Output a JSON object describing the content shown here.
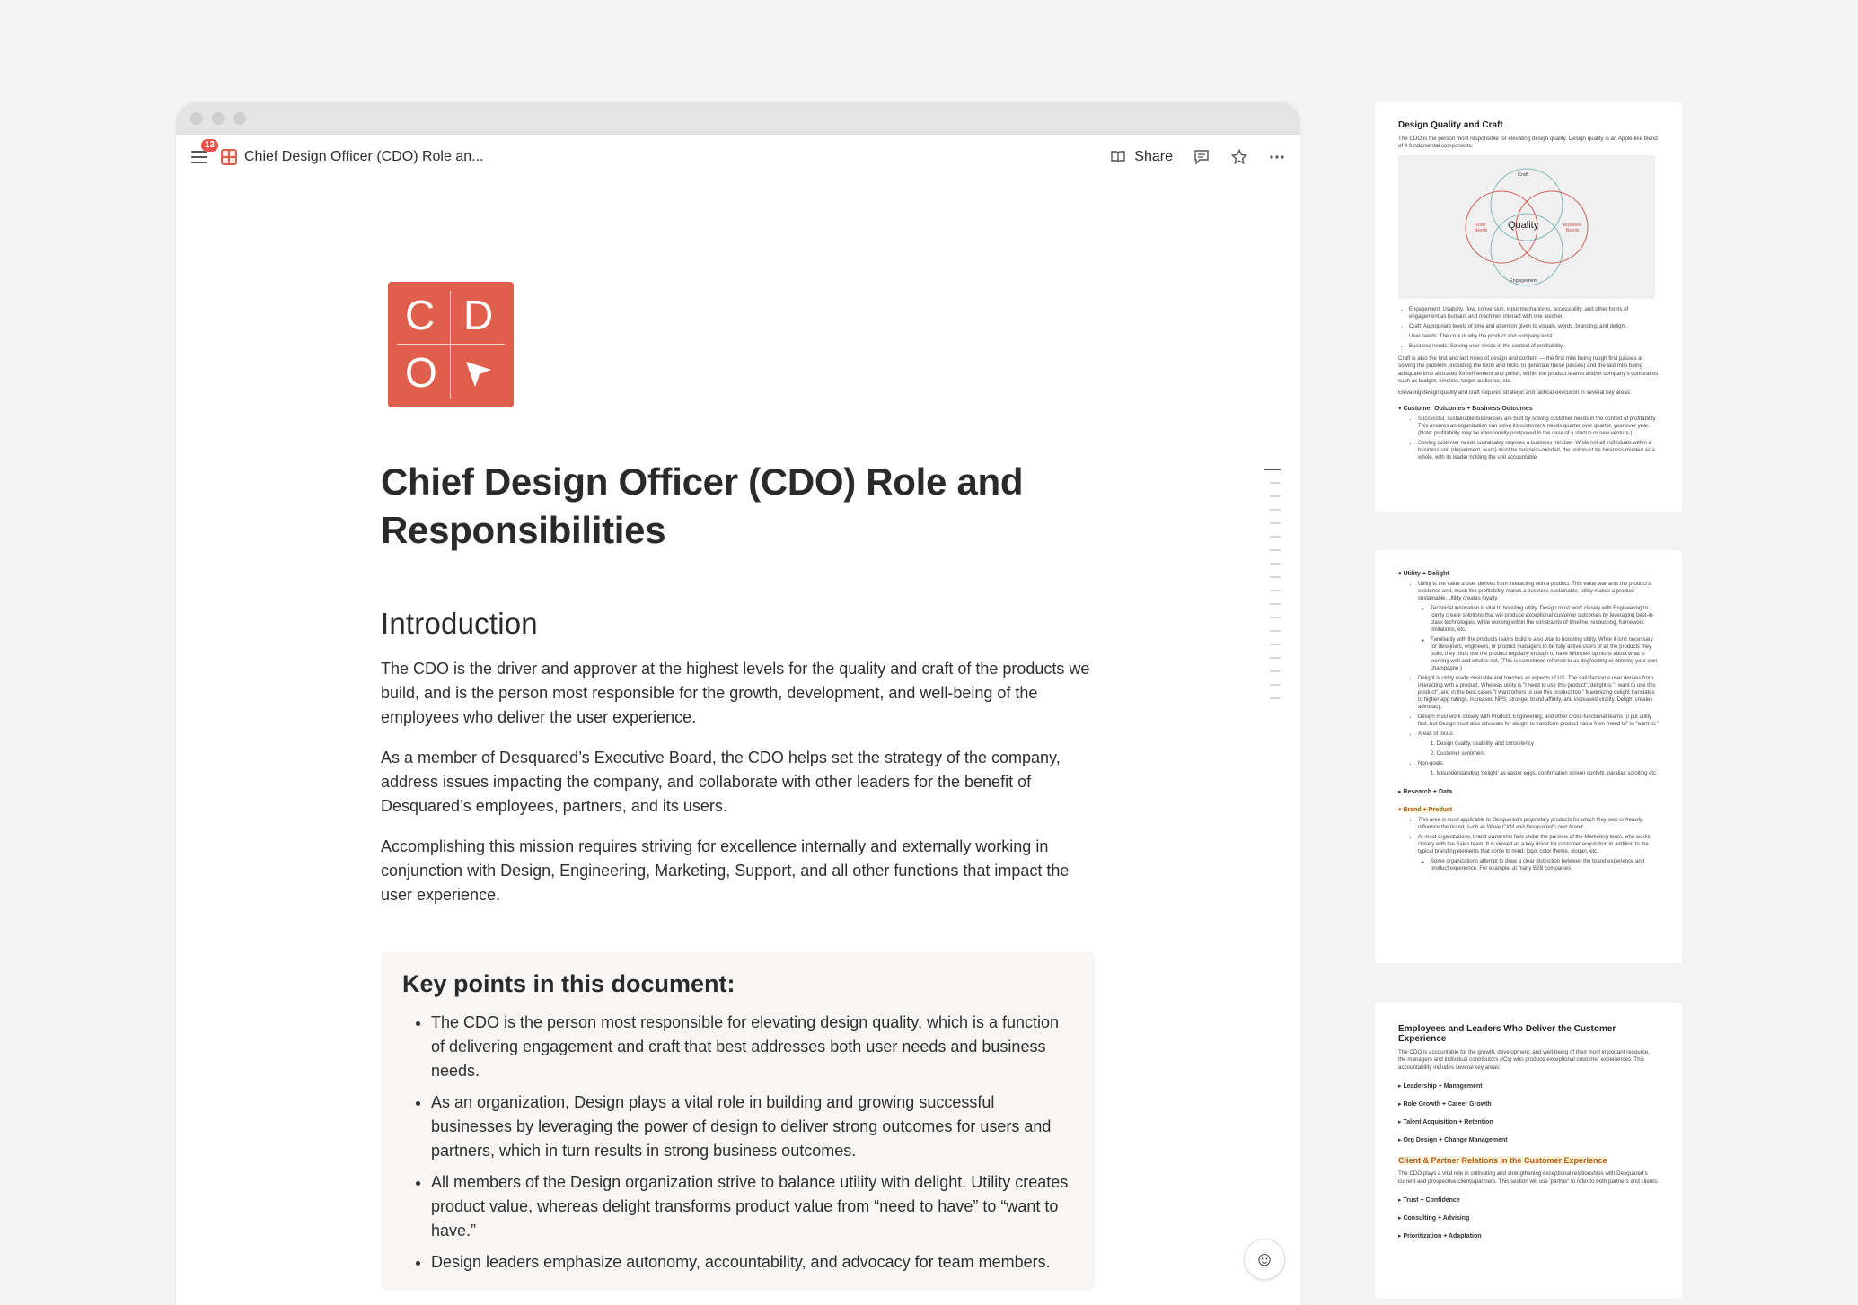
{
  "toolbar": {
    "notification_count": "13",
    "doc_title": "Chief Design Officer (CDO) Role an...",
    "share_label": "Share"
  },
  "logo": {
    "letters": [
      "C",
      "D",
      "O"
    ]
  },
  "document": {
    "title": "Chief Design Officer (CDO) Role and Responsibilities",
    "intro_heading": "Introduction",
    "paragraphs": [
      "The CDO is the driver and approver at the highest levels for the quality and craft of the products we build, and is the person most responsible for the growth, development, and well-being of the employees who deliver the user experience.",
      "As a member of Desquared’s Executive Board, the CDO helps set the strategy of the company, address issues impacting the company, and collaborate with other leaders for the benefit of Desquared’s employees, partners, and its users.",
      "Accomplishing this mission requires striving for excellence internally and externally working in conjunction with Design, Engineering, Marketing, Support, and all other functions that impact the user experience."
    ],
    "callout": {
      "heading": "Key points in this document:",
      "points": [
        "The CDO is the person most responsible for elevating design quality, which is a function of delivering engagement and craft that best addresses both user needs and business needs.",
        "As an organization, Design plays a vital role in building and growing successful businesses by leveraging the power of design to deliver strong outcomes for users and partners, which in turn results in strong business outcomes.",
        "All members of the Design organization strive to balance utility with delight. Utility creates product value, whereas delight transforms product value from “need to have” to “want to have.”",
        "Design leaders emphasize autonomy, accountability, and advocacy for team members."
      ]
    }
  },
  "thumb1": {
    "heading": "Design Quality and Craft",
    "intro": "The CDO is the person most responsible for elevating design quality. Design quality is an Apple-like blend of 4 fundamental components:",
    "venn": {
      "center": "Quality",
      "top": "Craft",
      "left": "User Needs",
      "right": "Business Needs",
      "bottom": "Engagement"
    },
    "bullets": [
      "Engagement: Usability, flow, conversion, input mechanisms, accessibility, and other forms of engagement as humans and machines interact with one another.",
      "Craft: Appropriate levels of time and attention given to visuals, words, branding, and delight.",
      "User needs: The crux of why the product and company exist.",
      "Business needs: Solving user needs in the context of profitability."
    ],
    "para1": "Craft is also the first and last miles of design and content — the first mile being rough first passes at solving the problem (including the tools and tricks to generate these passes) and the last mile being adequate time allocated for refinement and polish, within the product team's and/or company's constraints such as budget, timeline, target audience, etc.",
    "para2": "Elevating design quality and craft requires strategic and tactical execution in several key areas:",
    "toggle": "Customer Outcomes + Business Outcomes",
    "sub_bullets": [
      "Successful, sustainable businesses are built by solving customer needs in the context of profitability. This ensures an organization can solve its customers' needs quarter over quarter, year over year. (Note: profitability may be intentionally postponed in the case of a startup or new venture.)",
      "Solving customer needs sustainably requires a business mindset. While not all individuals within a business unit (department, team) must be business-minded, the unit must be business-minded as a whole, with its leader holding the unit accountable"
    ]
  },
  "thumb2": {
    "toggle1": "Utility + Delight",
    "bullets": [
      "Utility is the value a user derives from interacting with a product. This value warrants the product's existence and, much like profitability makes a business sustainable, utility makes a product sustainable. Utility creates loyalty.",
      "Technical innovation is vital to boosting utility. Design must work closely with Engineering to jointly create solutions that will produce exceptional customer outcomes by leveraging best-in-class technologies, while working within the constraints of timeline, resourcing, framework limitations, etc.",
      "Familiarity with the products teams build is also vital to boosting utility. While it isn't necessary for designers, engineers, or product managers to be fully active users of all the products they build, they must use the product regularly enough to have informed opinions about what is working well and what is not. (This is sometimes referred to as dogfooding or drinking your own champagne.)",
      "Delight is utility made desirable and touches all aspects of UX. The satisfaction a user derives from interacting with a product. Whereas utility is \"I need to use this product\", delight is \"I want to use this product\", and in the best cases \"I want others to use this product too.\" Maximizing delight translates to higher app ratings, increased NPS, stronger brand affinity, and increased virality. Delight creates advocacy.",
      "Design must work closely with Product, Engineering, and other cross-functional teams to put utility first, but Design must also advocate for delight to transform product value from \"need to\" to \"want to.\"",
      "Areas of focus:",
      "1. Design quality, usability, and consistency",
      "2. Customer sentiment",
      "Non-goals:",
      "1. Misunderstanding 'delight' as easter eggs, confirmation screen confetti, parallax scrolling etc."
    ],
    "toggle2": "Research + Data",
    "toggle3": "Brand + Product",
    "brand_bullets": [
      "This area is most applicable to Desquared's proprietary products for which they own or heavily influence the brand, such as Wave CXM and Desquared's own brand.",
      "At most organizations, brand ownership falls under the purview of the Marketing team, who works closely with the Sales team. It is viewed as a key driver for customer acquisition in addition to the typical branding elements that come to mind: logo, color theme, slogan, etc.",
      "Some organizations attempt to draw a clear distinction between the brand experience and product experience. For example, at many B2B companies"
    ]
  },
  "thumb3": {
    "heading": "Employees and Leaders Who Deliver the Customer Experience",
    "intro": "The CDO is accountable for the growth, development, and well-being of their most important resource, the managers and individual contributors (ICs) who produce exceptional customer experiences. This accountability includes several key areas:",
    "toggles": [
      "Leadership + Management",
      "Role Growth + Career Growth",
      "Talent Acquisition + Retention",
      "Org Design + Change Management"
    ],
    "subheading": "Client & Partner Relations in the Customer Experience",
    "intro2": "The CDO plays a vital role in cultivating and strengthening exceptional relationships with Desquared's current and prospective clients/partners. This section will use 'partner' to refer to both partners and clients.",
    "toggles2": [
      "Trust + Confidence",
      "Consulting + Advising",
      "Prioritization + Adaptation"
    ]
  },
  "colors": {
    "accent": "#df5f4c",
    "badge": "#e5534b",
    "callout_bg": "#f7f6f4",
    "page_bg": "#f3f3f3"
  },
  "icons": [
    "menu-icon",
    "book-icon",
    "comment-icon",
    "star-icon",
    "more-icon",
    "assistant-icon"
  ]
}
